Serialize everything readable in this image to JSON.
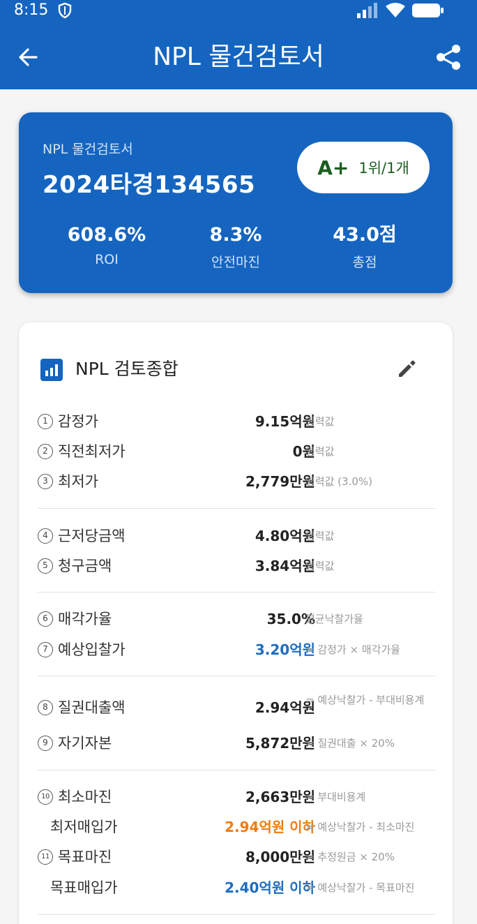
{
  "status_bar": {
    "time": "8:15"
  },
  "app_bar": {
    "title": "NPL 물건검토서"
  },
  "hero": {
    "subtitle": "NPL 물건검토서",
    "case_no": "2024타경134565",
    "grade": "A+",
    "rank": "1위/1개",
    "stats": [
      {
        "value": "608.6%",
        "label": "ROI"
      },
      {
        "value": "8.3%",
        "label": "안전마진"
      },
      {
        "value": "43.0점",
        "label": "총점"
      }
    ]
  },
  "review": {
    "title": "NPL 검토종합",
    "rows": [
      {
        "num": "1",
        "label": "감정가",
        "value": "9.15억원",
        "note": "입력값"
      },
      {
        "num": "2",
        "label": "직전최저가",
        "value": "0원",
        "note": "입력값"
      },
      {
        "num": "3",
        "label": "최저가",
        "value": "2,779만원",
        "note": "입력값 (3.0%)"
      },
      {
        "num": "4",
        "label": "근저당금액",
        "value": "4.80억원",
        "note": "입력값"
      },
      {
        "num": "5",
        "label": "청구금액",
        "value": "3.84억원",
        "note": "입력값"
      },
      {
        "num": "6",
        "label": "매각가율",
        "value": "35.0%",
        "note": "평균낙찰가율"
      },
      {
        "num": "7",
        "label": "예상입찰가",
        "value": "3.20억원",
        "note": "= 감정가 × 매각가율"
      },
      {
        "num": "8",
        "label": "질권대출액",
        "value": "2.94억원",
        "note": "= 예상낙찰가 - 부대비용계"
      },
      {
        "num": "9",
        "label": "자기자본",
        "value": "5,872만원",
        "note": "= 질권대출 × 20%"
      },
      {
        "num": "10",
        "label": "최소마진",
        "value": "2,663만원",
        "note": "= 부대비용계"
      },
      {
        "num": "",
        "label": "최저매입가",
        "value": "2.94억원 이하",
        "note": "= 예상낙찰가 - 최소마진"
      },
      {
        "num": "11",
        "label": "목표마진",
        "value": "8,000만원",
        "note": "= 추정원금 × 20%"
      },
      {
        "num": "",
        "label": "목표매입가",
        "value": "2.40억원 이하",
        "note": "= 예상낙찰가 - 목표마진"
      }
    ]
  },
  "colors": {
    "primary": "#1565c0",
    "grade": "#1b5e20",
    "value_blue": "#1e6cc0",
    "value_orange": "#ef7c12"
  }
}
